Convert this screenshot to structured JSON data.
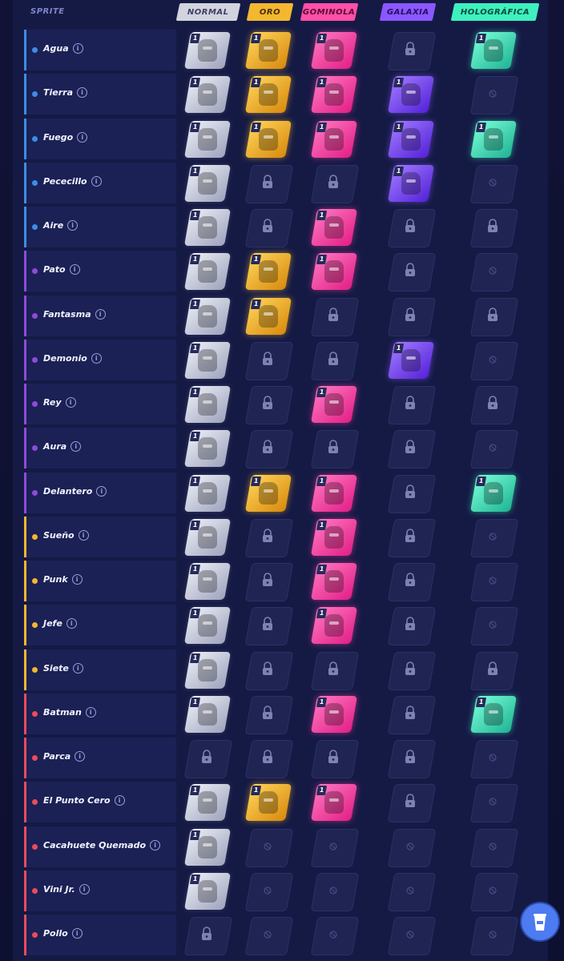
{
  "header": {
    "sprite_label": "SPRITE",
    "columns": [
      "NORMAL",
      "ORO",
      "GOMINOLA",
      "GALAXIA",
      "HOLOGRÁFICA"
    ]
  },
  "info_glyph": "i",
  "badge_value": "1",
  "colors": {
    "water": "#3b8ee6",
    "purple": "#8d4bd9",
    "gold": "#f3b730",
    "red": "#ea4b5c",
    "normal": "#d1d4de",
    "oro": "#f3b730",
    "gominola": "#ff4fa6",
    "galaxia": "#8b57ff",
    "holografica": "#3ef0be"
  },
  "legend_states": {
    "owned": "card with 1 badge",
    "lock": "lock-icon",
    "no": "unavailable-icon",
    "empty": "blank"
  },
  "rows": [
    {
      "name": "Agua",
      "color": "water",
      "states": [
        "owned",
        "owned",
        "owned",
        "lock",
        "owned"
      ]
    },
    {
      "name": "Tierra",
      "color": "water",
      "states": [
        "owned",
        "owned",
        "owned",
        "owned",
        "no"
      ]
    },
    {
      "name": "Fuego",
      "color": "water",
      "states": [
        "owned",
        "owned",
        "owned",
        "owned",
        "owned"
      ]
    },
    {
      "name": "Pececillo",
      "color": "water",
      "states": [
        "owned",
        "lock",
        "lock",
        "owned",
        "no"
      ]
    },
    {
      "name": "Aire",
      "color": "water",
      "states": [
        "owned",
        "lock",
        "owned",
        "lock",
        "lock"
      ]
    },
    {
      "name": "Pato",
      "color": "purple",
      "states": [
        "owned",
        "owned",
        "owned",
        "lock",
        "no"
      ]
    },
    {
      "name": "Fantasma",
      "color": "purple",
      "states": [
        "owned",
        "owned",
        "lock",
        "lock",
        "lock"
      ]
    },
    {
      "name": "Demonio",
      "color": "purple",
      "states": [
        "owned",
        "lock",
        "lock",
        "owned",
        "no"
      ]
    },
    {
      "name": "Rey",
      "color": "purple",
      "states": [
        "owned",
        "lock",
        "owned",
        "lock",
        "lock"
      ]
    },
    {
      "name": "Aura",
      "color": "purple",
      "states": [
        "owned",
        "lock",
        "lock",
        "lock",
        "no"
      ]
    },
    {
      "name": "Delantero",
      "color": "purple",
      "states": [
        "owned",
        "owned",
        "owned",
        "lock",
        "owned"
      ]
    },
    {
      "name": "Sueño",
      "color": "gold",
      "states": [
        "owned",
        "lock",
        "owned",
        "lock",
        "no"
      ]
    },
    {
      "name": "Punk",
      "color": "gold",
      "states": [
        "owned",
        "lock",
        "owned",
        "lock",
        "no"
      ]
    },
    {
      "name": "Jefe",
      "color": "gold",
      "states": [
        "owned",
        "lock",
        "owned",
        "lock",
        "no"
      ]
    },
    {
      "name": "Siete",
      "color": "gold",
      "states": [
        "owned",
        "lock",
        "lock",
        "lock",
        "lock"
      ]
    },
    {
      "name": "Batman",
      "color": "red",
      "states": [
        "owned",
        "lock",
        "owned",
        "lock",
        "owned"
      ]
    },
    {
      "name": "Parca",
      "color": "red",
      "states": [
        "lock",
        "lock",
        "lock",
        "lock",
        "no"
      ]
    },
    {
      "name": "El Punto Cero",
      "color": "red",
      "states": [
        "owned",
        "owned",
        "owned",
        "lock",
        "no"
      ]
    },
    {
      "name": "Cacahuete Quemado",
      "color": "red",
      "states": [
        "owned",
        "no",
        "no",
        "no",
        "no"
      ]
    },
    {
      "name": "Vini Jr.",
      "color": "red",
      "states": [
        "owned",
        "no",
        "no",
        "no",
        "no"
      ]
    },
    {
      "name": "Pollo",
      "color": "red",
      "states": [
        "lock",
        "no",
        "no",
        "no",
        "no"
      ]
    }
  ]
}
